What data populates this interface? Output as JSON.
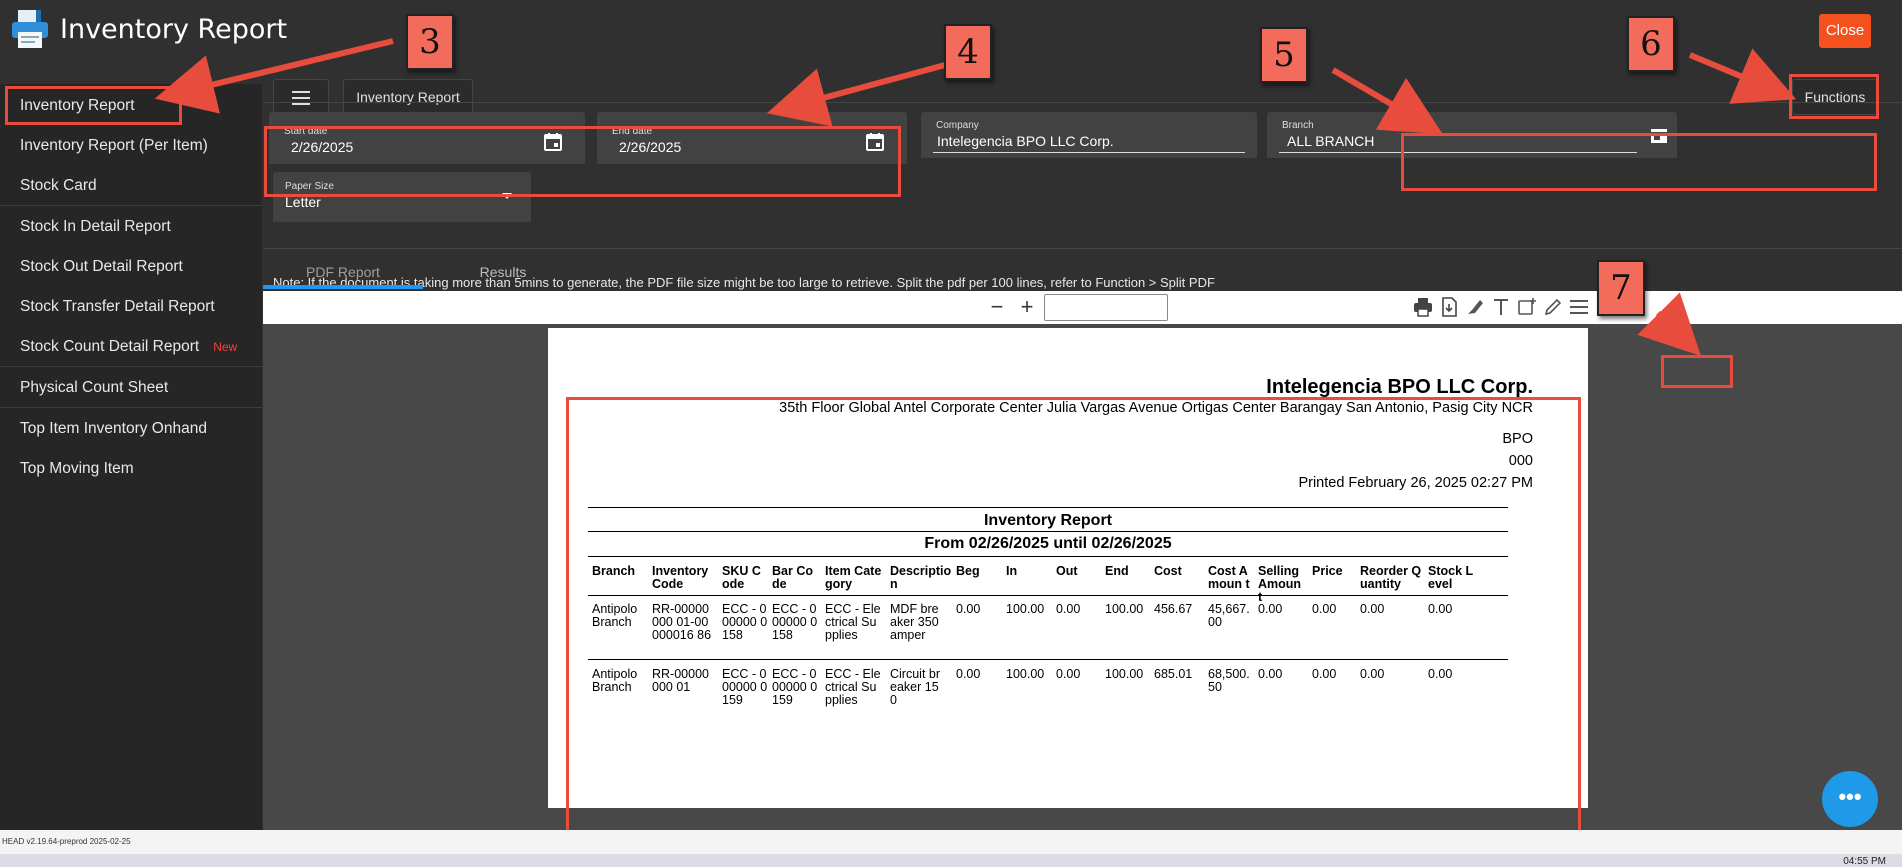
{
  "window": {
    "title": "Inventory Report",
    "close_label": "Close"
  },
  "sidebar": {
    "items": [
      {
        "label": "Inventory Report"
      },
      {
        "label": "Inventory Report (Per Item)"
      },
      {
        "label": "Stock Card"
      },
      {
        "label": "Stock In Detail Report"
      },
      {
        "label": "Stock Out Detail Report"
      },
      {
        "label": "Stock Transfer Detail Report"
      },
      {
        "label": "Stock Count Detail Report",
        "badge": "New"
      },
      {
        "label": "Physical Count Sheet"
      },
      {
        "label": "Top Item Inventory Onhand"
      },
      {
        "label": "Top Moving Item"
      }
    ]
  },
  "toolbar": {
    "report_button": "Inventory Report",
    "functions_button": "Functions"
  },
  "filters": {
    "start_date": {
      "label": "Start date",
      "value": "2/26/2025"
    },
    "end_date": {
      "label": "End date",
      "value": "2/26/2025"
    },
    "company": {
      "label": "Company",
      "value": "Intelegencia BPO LLC Corp."
    },
    "branch": {
      "label": "Branch",
      "value": "ALL BRANCH"
    },
    "paper_size": {
      "label": "Paper Size",
      "value": "Letter"
    }
  },
  "note": "Note: If the document is taking more than 5mins to generate, the PDF file size might be too large to retrieve. Split the pdf per 100 lines, refer to Function > Split PDF",
  "tabs": [
    {
      "label": "PDF Report"
    },
    {
      "label": "Results"
    }
  ],
  "pdf": {
    "zoom_out": "−",
    "zoom_in": "+",
    "company": "Intelegencia BPO LLC Corp.",
    "address": "35th Floor Global Antel Corporate Center Julia Vargas Avenue Ortigas Center Barangay San Antonio, Pasig City  NCR",
    "line2": "BPO",
    "line3": "000",
    "printed": "Printed February 26, 2025 02:27 PM",
    "report_title": "Inventory Report",
    "date_range": "From 02/26/2025 until 02/26/2025",
    "columns": [
      "Branch",
      "Inventory Code",
      "SKU Code",
      "Bar Code",
      "Item Category",
      "Descriptio n",
      "Beg",
      "In",
      "Out",
      "End",
      "Cost",
      "Cost Amoun t",
      "Selling Amoun t",
      "Price",
      "Reorder Quantity",
      "Stock Level"
    ],
    "rows": [
      [
        "Antipolo Branch",
        "RR-00000000 01-00000016 86",
        "ECC - 000000 0158",
        "ECC - 000000 0158",
        "ECC - Electrical Supplies",
        "MDF breaker 350 amper",
        "0.00",
        "100.00",
        "0.00",
        "100.00",
        "456.67",
        "45,667. 00",
        "0.00",
        "0.00",
        "0.00",
        "0.00"
      ],
      [
        "Antipolo Branch",
        "RR-00000000 01",
        "ECC - 000000 0159",
        "ECC - 000000 0159",
        "ECC - Electrical Supplies",
        "Circuit breaker 150",
        "0.00",
        "100.00",
        "0.00",
        "100.00",
        "685.01",
        "68,500. 50",
        "0.00",
        "0.00",
        "0.00",
        "0.00"
      ]
    ]
  },
  "annotations": [
    "3",
    "4",
    "5",
    "6",
    "7"
  ],
  "status": {
    "version": "HEAD v2.19.64-preprod 2025-02-25",
    "clock": "04:55 PM"
  },
  "chat_glyph": "•••",
  "colors": {
    "accent": "#f4511e",
    "tab_indicator": "#2196f3",
    "annotation": "#e74c3c",
    "chat": "#1e9ae8"
  }
}
